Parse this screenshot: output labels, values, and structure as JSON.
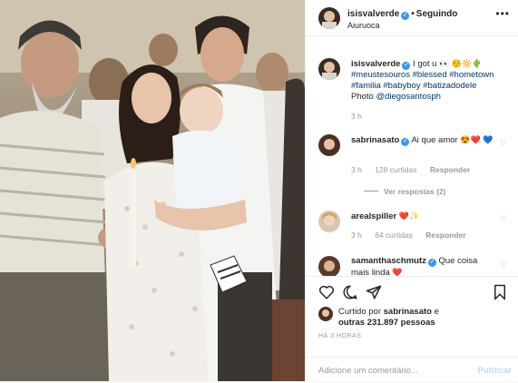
{
  "header": {
    "username": "isisvalverde",
    "follow_status": "Seguindo",
    "location": "Aiuruoca",
    "more_label": "•••"
  },
  "caption": {
    "username": "isisvalverde",
    "text_start": "I got u",
    "hashtags": "#meustesouros #blessed #hometown #familia #babyboy #batizadodele",
    "photo_credit_label": "Photo",
    "photo_credit_user": "@diegosantosph",
    "time": "3 h",
    "emoji": "👀 ☺️🔆🌵"
  },
  "comments": [
    {
      "username": "sabrinasato",
      "text": "Ai que amor",
      "emoji": "😍❤️",
      "emoji2": "💙",
      "time": "3 h",
      "likes": "128 curtidas",
      "reply_label": "Responder",
      "view_replies": "Ver respostas (2)"
    },
    {
      "username": "arealspiller",
      "text": "",
      "emoji": "❤️✨",
      "time": "3 h",
      "likes": "64 curtidas",
      "reply_label": "Responder"
    },
    {
      "username": "samanthaschmutz",
      "text": "Que coisa mais linda",
      "emoji": "❤️"
    }
  ],
  "actions": {
    "liked_by_prefix": "Curtido por",
    "liked_by_user": "sabrinasato",
    "liked_and": "e",
    "liked_others": "outras 231.897 pessoas",
    "time_ago": "HÁ 3 HORAS"
  },
  "add_comment": {
    "placeholder": "Adicione um comentário...",
    "publish_label": "Publicar"
  },
  "colors": {
    "verified": "#3897f0",
    "link": "#003569",
    "publish_disabled": "#b2dffc"
  }
}
